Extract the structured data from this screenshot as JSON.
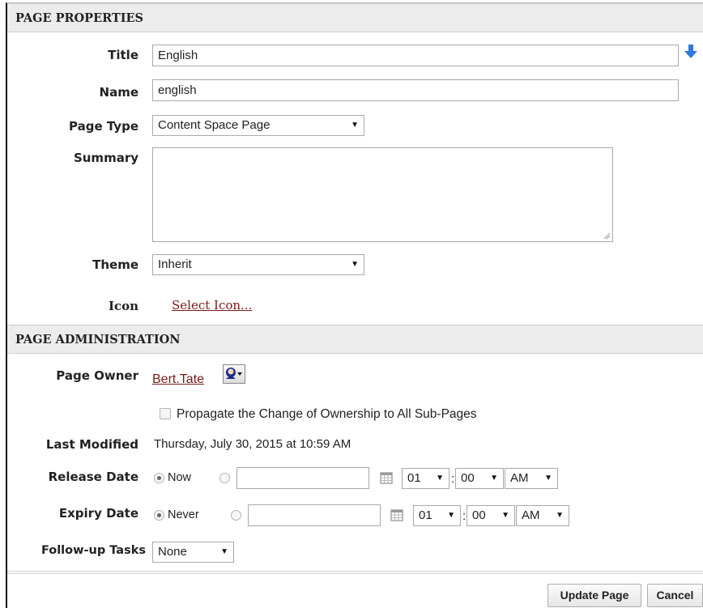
{
  "properties": {
    "header": "PAGE PROPERTIES",
    "title_label": "Title",
    "title_value": "English",
    "name_label": "Name",
    "name_value": "english",
    "page_type_label": "Page Type",
    "page_type_value": "Content Space Page",
    "summary_label": "Summary",
    "summary_value": "",
    "theme_label": "Theme",
    "theme_value": "Inherit",
    "icon_label": "Icon",
    "icon_link": "Select Icon..."
  },
  "administration": {
    "header": "PAGE ADMINISTRATION",
    "owner_label": "Page Owner",
    "owner_value": "Bert.Tate",
    "propagate_label": "Propagate the Change of Ownership to All Sub-Pages",
    "propagate_checked": false,
    "last_modified_label": "Last Modified",
    "last_modified_value": "Thursday, July 30, 2015 at 10:59 AM",
    "release": {
      "label": "Release Date",
      "option_label": "Now",
      "hour": "01",
      "minute": "00",
      "ampm": "AM",
      "separator": ":"
    },
    "expiry": {
      "label": "Expiry Date",
      "option_label": "Never",
      "hour": "01",
      "minute": "00",
      "ampm": "AM",
      "separator": ":"
    },
    "followup_label": "Follow-up Tasks",
    "followup_value": "None"
  },
  "footer": {
    "update_label": "Update Page",
    "cancel_label": "Cancel"
  },
  "icons": {
    "title_action": "arrow-down-icon",
    "owner_picker": "user-picker-icon",
    "calendar": "calendar-icon"
  },
  "colors": {
    "link": "#7b1a1a",
    "arrow_blue": "#2d7be0",
    "header_bg": "#ececec"
  }
}
